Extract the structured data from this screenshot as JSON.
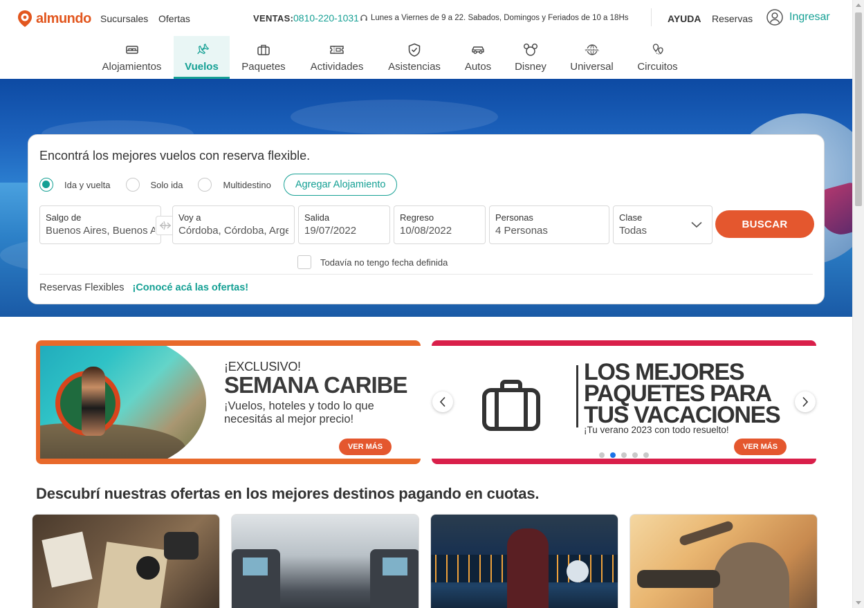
{
  "header": {
    "brand": "almundo",
    "links": [
      "Sucursales",
      "Ofertas"
    ],
    "ventas_label": "VENTAS:",
    "phone": "0810-220-1031",
    "hours": "Lunes a Viernes de 9 a 22. Sabados, Domingos y Feriados de 10 a 18Hs",
    "ayuda": "AYUDA",
    "reservas": "Reservas",
    "ingresar": "Ingresar"
  },
  "nav": {
    "active": "Vuelos",
    "items": [
      {
        "label": "Alojamientos",
        "icon": "bed-icon"
      },
      {
        "label": "Vuelos",
        "icon": "plane-icon"
      },
      {
        "label": "Paquetes",
        "icon": "suitcase-icon"
      },
      {
        "label": "Actividades",
        "icon": "ticket-icon"
      },
      {
        "label": "Asistencias",
        "icon": "shield-icon"
      },
      {
        "label": "Autos",
        "icon": "car-icon"
      },
      {
        "label": "Disney",
        "icon": "mickey-icon"
      },
      {
        "label": "Universal",
        "icon": "universal-globe-icon"
      },
      {
        "label": "Circuitos",
        "icon": "map-pins-icon"
      }
    ]
  },
  "search": {
    "title": "Encontrá los mejores vuelos con reserva flexible.",
    "trip_types": [
      {
        "label": "Ida y vuelta",
        "checked": true
      },
      {
        "label": "Solo ida",
        "checked": false
      },
      {
        "label": "Multidestino",
        "checked": false
      }
    ],
    "agregar_alojamiento": "Agregar Alojamiento",
    "origin": {
      "label": "Salgo de",
      "value": "Buenos Aires, Buenos Aires, Argentina"
    },
    "destination": {
      "label": "Voy a",
      "value": "Córdoba, Córdoba, Argentina"
    },
    "departure": {
      "label": "Salida",
      "value": "19/07/2022"
    },
    "return": {
      "label": "Regreso",
      "value": "10/08/2022"
    },
    "passengers": {
      "label": "Personas",
      "value": "4 Personas"
    },
    "cabin": {
      "label": "Clase",
      "value": "Todas"
    },
    "submit": "BUSCAR",
    "no_date": "Todavía no tengo fecha definida",
    "flex_label": "Reservas Flexibles",
    "flex_link": "¡Conocé acá las ofertas!"
  },
  "banners": {
    "left": {
      "kicker": "¡EXCLUSIVO!",
      "title": "SEMANA CARIBE",
      "desc": "¡Vuelos, hoteles y todo lo que necesitás al mejor precio!",
      "cta": "VER MÁS"
    },
    "right": {
      "title": "LOS MEJORES PAQUETES PARA TUS VACACIONES",
      "sub": "¡Tu verano 2023 con todo resuelto!",
      "cta": "VER MÁS"
    },
    "carousel_dots": 5,
    "carousel_active": 1
  },
  "offers": {
    "title": "Descubrí nuestras ofertas en los mejores destinos pagando en cuotas."
  },
  "colors": {
    "brand_orange": "#e4572e",
    "teal": "#15a094",
    "caribe_orange": "#e8692b",
    "paquetes_red": "#d91f4a",
    "dot_active": "#1a73e8"
  }
}
